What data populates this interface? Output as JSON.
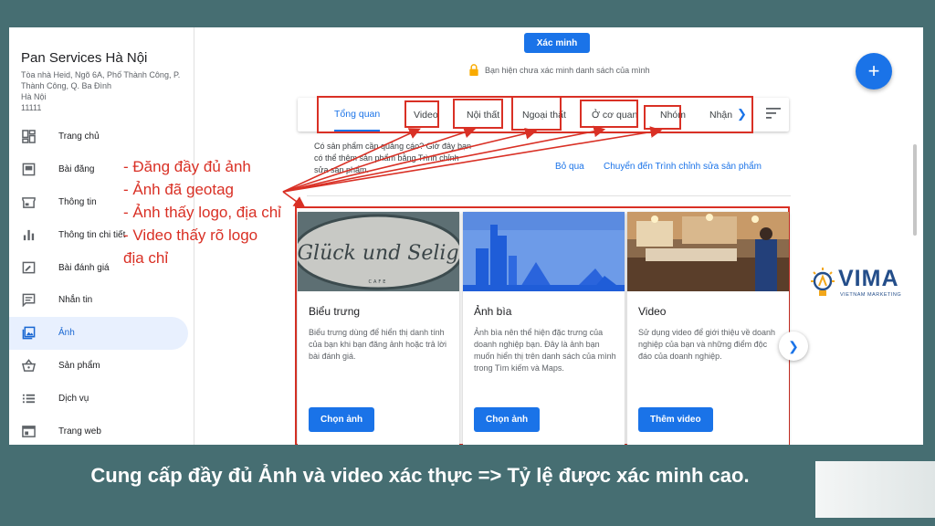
{
  "business": {
    "name": "Pan Services Hà Nội",
    "address": "Tòa nhà Heid, Ngõ 6A, Phố Thành Công, P. Thành Công, Q. Ba Đình",
    "city": "Hà Nội",
    "postal": "11111"
  },
  "sidebar": {
    "items": [
      {
        "label": "Trang chủ",
        "icon": "dashboard-icon"
      },
      {
        "label": "Bài đăng",
        "icon": "post-icon"
      },
      {
        "label": "Thông tin",
        "icon": "store-icon"
      },
      {
        "label": "Thông tin chi tiết",
        "icon": "bar-chart-icon"
      },
      {
        "label": "Bài đánh giá",
        "icon": "review-icon"
      },
      {
        "label": "Nhắn tin",
        "icon": "message-icon"
      },
      {
        "label": "Ảnh",
        "icon": "photo-icon",
        "active": true
      },
      {
        "label": "Sản phẩm",
        "icon": "basket-icon"
      },
      {
        "label": "Dịch vụ",
        "icon": "list-icon"
      },
      {
        "label": "Trang web",
        "icon": "web-icon"
      }
    ]
  },
  "header": {
    "verify_label": "Xác minh",
    "lock_text": "Bạn hiện chưa xác minh danh sách của mình",
    "fab_label": "+"
  },
  "tabs": [
    {
      "label": "Tổng quan",
      "active": true
    },
    {
      "label": "Video"
    },
    {
      "label": "Nội thất"
    },
    {
      "label": "Ngoại thất"
    },
    {
      "label": "Ở cơ quan"
    },
    {
      "label": "Nhóm"
    },
    {
      "label": "Nhận"
    }
  ],
  "promo": {
    "text": "Có sản phẩm cần quảng cáo? Giờ đây bạn có thể thêm sản phẩm bằng Trình chỉnh sửa sản phẩm.",
    "skip_label": "Bỏ qua",
    "editor_label": "Chuyển đến Trình chỉnh sửa sản phẩm"
  },
  "annotation": {
    "lines": [
      "- Đăng đầy đủ ảnh",
      "- Ảnh đã geotag",
      "- Ảnh thấy logo, địa chỉ",
      "- Video thấy rõ logo",
      "địa chỉ"
    ],
    "color": "#d93025"
  },
  "cards": [
    {
      "title": "Biểu trưng",
      "desc": "Biểu trưng dùng để hiển thị danh tính của bạn khi bạn đăng ảnh hoặc trả lời bài đánh giá.",
      "button": "Chọn ảnh",
      "logo_script": "Glück und Selig",
      "logo_sub": "CAFE"
    },
    {
      "title": "Ảnh bìa",
      "desc": "Ảnh bìa nên thể hiện đặc trưng của doanh nghiệp bạn. Đây là ảnh bạn muốn hiển thị trên danh sách của mình trong Tìm kiếm và Maps.",
      "button": "Chọn ảnh"
    },
    {
      "title": "Video",
      "desc": "Sử dụng video để giới thiệu về doanh nghiệp của bạn và những điểm độc đáo của doanh nghiệp.",
      "button": "Thêm video"
    }
  ],
  "brand": {
    "name": "VIMA",
    "tagline": "VIETNAM MARKETING",
    "color": "#244e8a"
  },
  "caption": "Cung cấp đầy đủ Ảnh và video xác thực => Tỷ lệ được xác minh cao.",
  "colors": {
    "accent": "#1a73e8",
    "background": "#466e72"
  }
}
